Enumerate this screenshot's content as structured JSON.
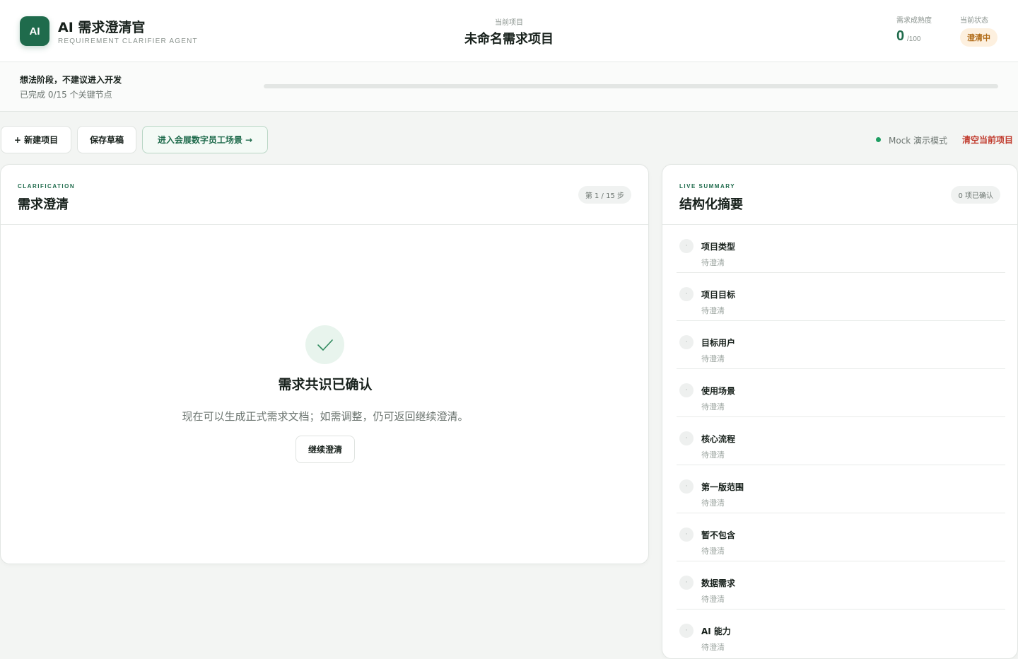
{
  "header": {
    "logo_text": "AI",
    "app_title": "AI 需求澄清官",
    "app_subtitle": "REQUIREMENT CLARIFIER AGENT",
    "project_label": "当前项目",
    "project_name": "未命名需求项目",
    "maturity_label": "需求成熟度",
    "maturity_value": "0",
    "maturity_max": "/100",
    "state_label": "当前状态",
    "state_value": "澄清中"
  },
  "stage": {
    "title": "想法阶段，不建议进入开发",
    "subtitle": "已完成 0/15 个关键节点",
    "progress_fraction": 0
  },
  "toolbar": {
    "new_project": "+ 新建项目",
    "save_draft": "保存草稿",
    "enter_scene": "进入会展数字员工场景 →",
    "mock_mode": "Mock 演示模式",
    "clear_project": "清空当前项目"
  },
  "clarification": {
    "eyebrow": "CLARIFICATION",
    "title": "需求澄清",
    "step": "第 1 / 15 步",
    "confirm_title": "需求共识已确认",
    "confirm_desc": "现在可以生成正式需求文档；如需调整，仍可返回继续澄清。",
    "continue_button": "继续澄清"
  },
  "summary": {
    "eyebrow": "LIVE SUMMARY",
    "title": "结构化摘要",
    "confirmed_count": "0 项已确认",
    "items": [
      {
        "name": "项目类型",
        "status": "待澄清"
      },
      {
        "name": "项目目标",
        "status": "待澄清"
      },
      {
        "name": "目标用户",
        "status": "待澄清"
      },
      {
        "name": "使用场景",
        "status": "待澄清"
      },
      {
        "name": "核心流程",
        "status": "待澄清"
      },
      {
        "name": "第一版范围",
        "status": "待澄清"
      },
      {
        "name": "暂不包含",
        "status": "待澄清"
      },
      {
        "name": "数据需求",
        "status": "待澄清"
      },
      {
        "name": "AI 能力",
        "status": "待澄清"
      }
    ]
  },
  "colors": {
    "accent": "#1f6b4c",
    "state_badge_bg": "#fdf0df",
    "state_badge_text": "#b06a16",
    "danger": "#c0392b",
    "mock_dot": "#1e9e62"
  }
}
